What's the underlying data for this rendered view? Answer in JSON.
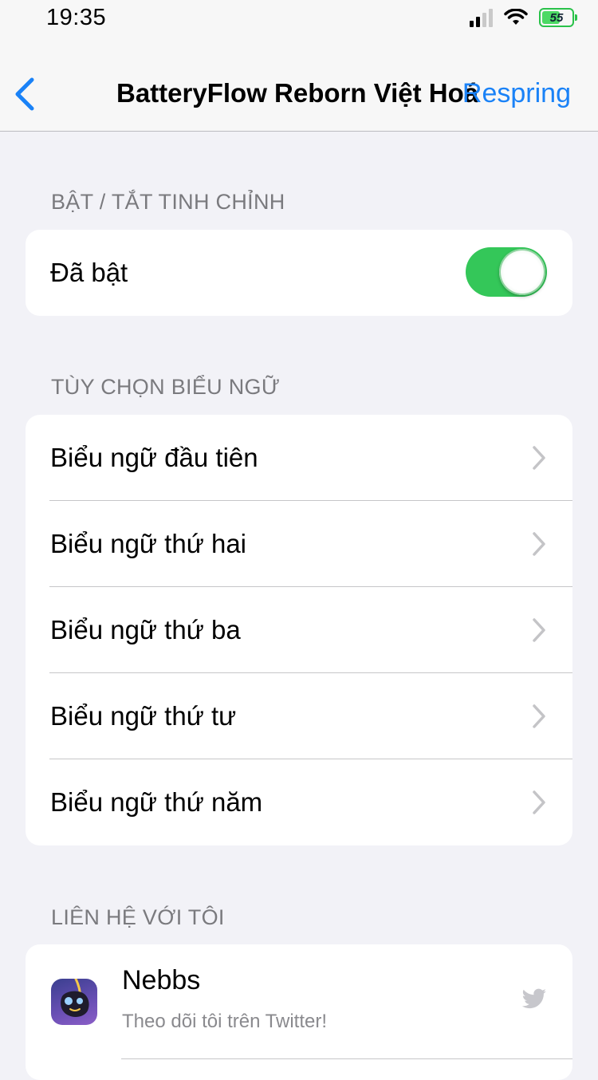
{
  "status_bar": {
    "time": "19:35",
    "battery_level": "55",
    "icons": [
      "cellular-signal-icon",
      "wifi-icon",
      "battery-icon"
    ]
  },
  "nav": {
    "back_icon": "chevron-left-icon",
    "title": "BatteryFlow Reborn Việt Hoá",
    "action_label": "Respring"
  },
  "colors": {
    "accent": "#1a82f7",
    "toggle_on": "#34c759",
    "background": "#f2f2f7",
    "battery_green": "#4cd964"
  },
  "sections": {
    "toggle_section": {
      "header": "BẬT / TẮT TINH CHỈNH",
      "enabled_label": "Đã bật",
      "enabled_value": true
    },
    "banner_section": {
      "header": "TÙY CHỌN BIỂU NGỮ",
      "items": [
        {
          "label": "Biểu ngữ đầu tiên"
        },
        {
          "label": "Biểu ngữ thứ hai"
        },
        {
          "label": "Biểu ngữ thứ ba"
        },
        {
          "label": "Biểu ngữ thứ tư"
        },
        {
          "label": "Biểu ngữ thứ năm"
        }
      ]
    },
    "contact_section": {
      "header": "LIÊN HỆ VỚI TÔI",
      "contacts": [
        {
          "name": "Nebbs",
          "subtitle": "Theo dõi tôi trên Twitter!",
          "icon": "twitter-icon"
        }
      ]
    }
  }
}
